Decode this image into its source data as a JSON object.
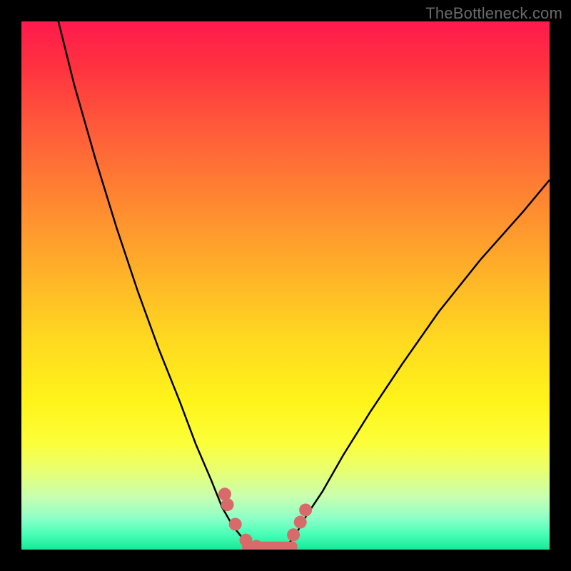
{
  "watermark": "TheBottleneck.com",
  "chart_data": {
    "type": "line",
    "title": "",
    "xlabel": "",
    "ylabel": "",
    "xlim": [
      0,
      100
    ],
    "ylim": [
      0,
      100
    ],
    "series": [
      {
        "name": "left-curve",
        "x": [
          7,
          10,
          14,
          18,
          22,
          26,
          30,
          33,
          36,
          38,
          40,
          42,
          43.5,
          45
        ],
        "y": [
          100,
          88,
          74,
          61,
          49,
          38,
          28,
          20,
          13,
          8,
          4.5,
          2,
          0.8,
          0.2
        ]
      },
      {
        "name": "right-curve",
        "x": [
          49,
          50.5,
          52,
          54,
          57,
          61,
          66,
          72,
          79,
          87,
          95,
          100
        ],
        "y": [
          0.2,
          1,
          3,
          6.5,
          11,
          18,
          26,
          35,
          45,
          55,
          64,
          70
        ]
      },
      {
        "name": "left-dots",
        "type": "scatter",
        "x": [
          38.5,
          39,
          40.5,
          42.5,
          44.5
        ],
        "y": [
          10.5,
          8.5,
          4.8,
          1.8,
          0.6
        ]
      },
      {
        "name": "right-dots",
        "type": "scatter",
        "x": [
          51.5,
          52.8,
          53.8
        ],
        "y": [
          2.8,
          5.2,
          7.5
        ]
      },
      {
        "name": "valley-bar",
        "type": "scatter",
        "x": [
          43,
          45,
          47,
          49,
          51
        ],
        "y": [
          0.3,
          0.3,
          0.3,
          0.3,
          0.3
        ]
      }
    ],
    "gradient_stops": [
      {
        "pos": 0,
        "color": "#ff1a4d"
      },
      {
        "pos": 8,
        "color": "#ff3040"
      },
      {
        "pos": 20,
        "color": "#ff5a3a"
      },
      {
        "pos": 35,
        "color": "#ff8a30"
      },
      {
        "pos": 48,
        "color": "#ffb328"
      },
      {
        "pos": 60,
        "color": "#ffd820"
      },
      {
        "pos": 72,
        "color": "#fff41a"
      },
      {
        "pos": 80,
        "color": "#fbff3a"
      },
      {
        "pos": 85,
        "color": "#e8ff70"
      },
      {
        "pos": 90,
        "color": "#c8ffb0"
      },
      {
        "pos": 94,
        "color": "#8effc8"
      },
      {
        "pos": 97,
        "color": "#4affb8"
      },
      {
        "pos": 100,
        "color": "#18e898"
      }
    ],
    "curve_color": "#000000",
    "marker_color": "#d96a6a"
  }
}
